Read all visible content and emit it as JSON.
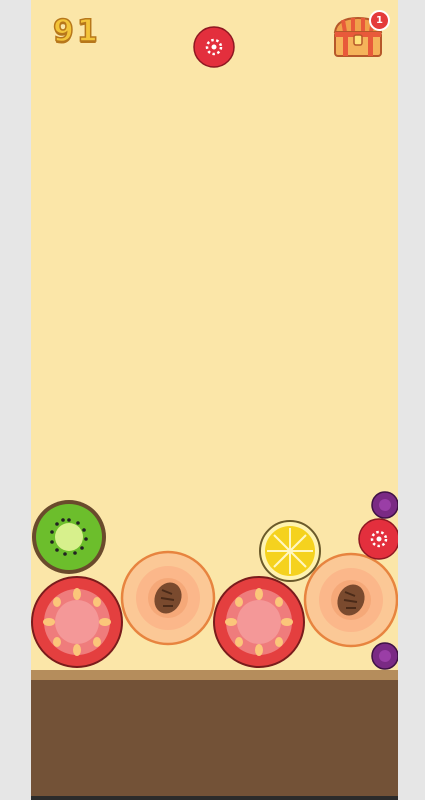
{
  "hud": {
    "score": "91",
    "chest_badge": "1"
  },
  "colors": {
    "background": "#fbe6a8",
    "ground": "#735237",
    "ground_edge": "#b58d5c",
    "score_fill": "#f3c43a"
  },
  "next_fruit": "strawberry",
  "board_fruits": [
    "kiwi",
    "tomato",
    "peach",
    "tomato",
    "lemon",
    "peach",
    "strawberry",
    "plum",
    "plum"
  ]
}
